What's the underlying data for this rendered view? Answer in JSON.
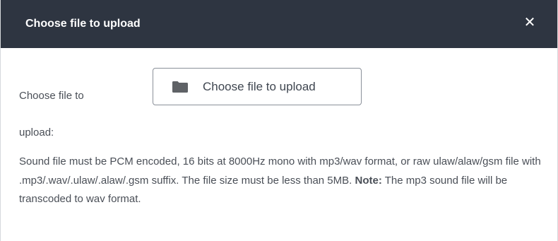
{
  "dialog": {
    "title": "Choose file to upload",
    "close_glyph": "✕",
    "close_icon": "close-icon",
    "accent_header_color": "#2e3541"
  },
  "form": {
    "label_line1": "Choose file to",
    "label_line2": "upload:",
    "upload_button": {
      "icon": "folder-icon",
      "label": "Choose file to upload"
    }
  },
  "help": {
    "text_before_note": "Sound file must be PCM encoded, 16 bits at 8000Hz mono with mp3/wav format, or raw ulaw/alaw/gsm file with .mp3/.wav/.ulaw/.alaw/.gsm suffix. The file size must be less than 5MB.",
    "note_label": "Note:",
    "text_after_note": "The mp3 sound file will be transcoded to wav format."
  }
}
